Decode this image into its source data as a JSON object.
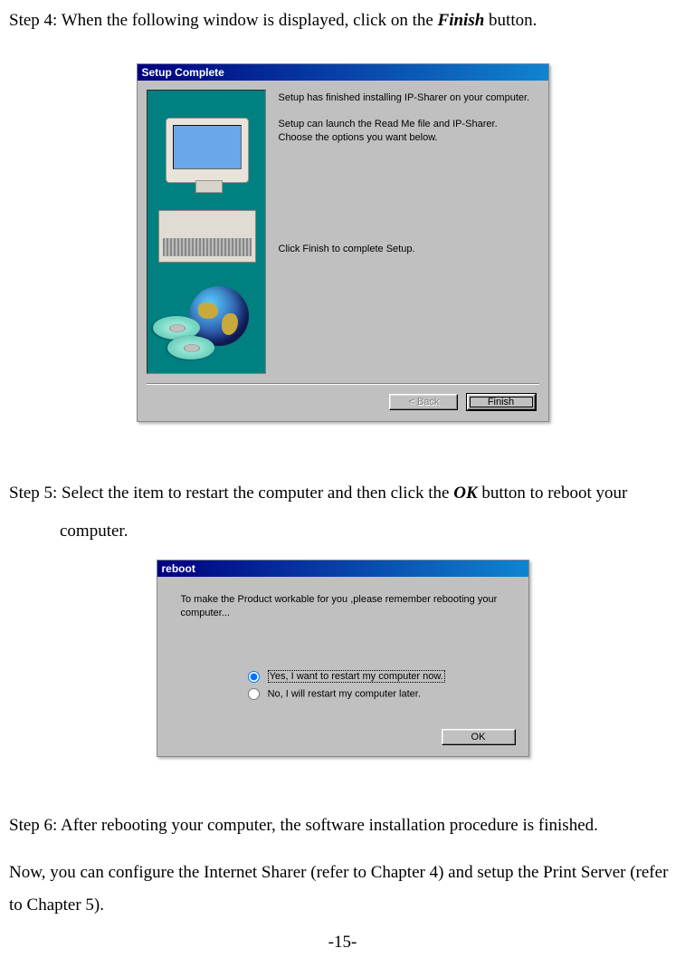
{
  "step4": {
    "label": "Step 4: When the following window is displayed, click on the ",
    "bold": "Finish",
    "tail": " button."
  },
  "dialog1": {
    "title": "Setup Complete",
    "line1": "Setup has finished installing IP-Sharer on your computer.",
    "line2": "Setup can launch the Read Me file and IP-Sharer. Choose the options you want below.",
    "line3": "Click Finish to complete Setup.",
    "back_button": "< Back",
    "finish_button": "Finish"
  },
  "step5": {
    "label_a": "Step 5: Select the item to restart the computer and then click the ",
    "bold": "OK",
    "label_b": " button to reboot your",
    "tail": "computer."
  },
  "dialog2": {
    "title": "reboot",
    "msg": "To make the Product workable for you ,please remember rebooting your computer...",
    "option1": "Yes, I want to restart my computer now.",
    "option2": "No, I will restart my computer later.",
    "ok_button": "OK"
  },
  "step6": "Step 6: After rebooting your computer, the software installation procedure is finished.",
  "closing": "Now, you can configure the Internet Sharer (refer to Chapter 4) and setup the Print Server (refer to Chapter 5).",
  "page_number": "-15-"
}
